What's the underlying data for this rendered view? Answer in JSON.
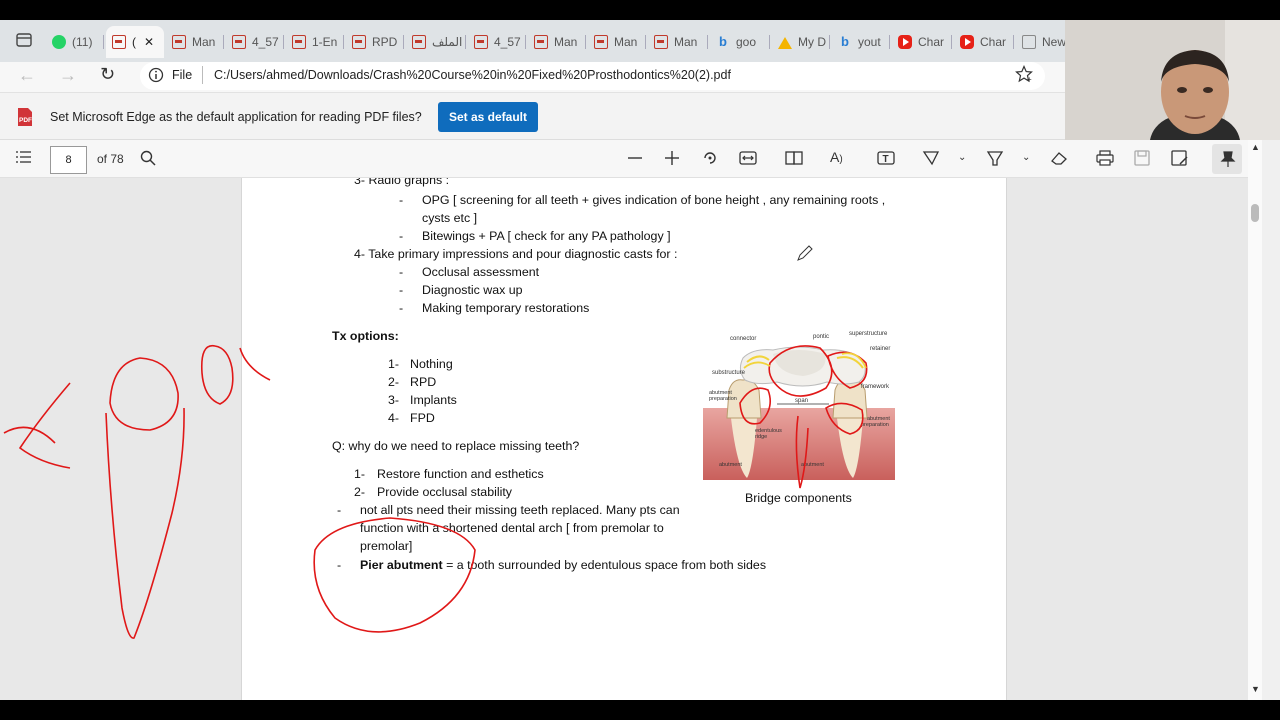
{
  "tabs": [
    {
      "label": "(11)",
      "icon": "whatsapp-icon"
    },
    {
      "label": "(",
      "icon": "pdf-icon",
      "active": true
    },
    {
      "label": "Man",
      "icon": "pdf-icon"
    },
    {
      "label": "4_57",
      "icon": "pdf-icon"
    },
    {
      "label": "1-En",
      "icon": "pdf-icon"
    },
    {
      "label": "RPD",
      "icon": "pdf-icon"
    },
    {
      "label": "الملف",
      "icon": "pdf-icon"
    },
    {
      "label": "4_57",
      "icon": "pdf-icon"
    },
    {
      "label": "Man",
      "icon": "pdf-icon"
    },
    {
      "label": "Man",
      "icon": "pdf-icon"
    },
    {
      "label": "Man",
      "icon": "pdf-icon"
    },
    {
      "label": "goo",
      "icon": "bing-icon"
    },
    {
      "label": "My D",
      "icon": "drive-icon"
    },
    {
      "label": "yout",
      "icon": "bing-icon"
    },
    {
      "label": "Char",
      "icon": "youtube-icon"
    },
    {
      "label": "Char",
      "icon": "youtube-icon"
    },
    {
      "label": "New",
      "icon": "new-tab-icon"
    }
  ],
  "addressbar": {
    "file_label": "File",
    "url": "C:/Users/ahmed/Downloads/Crash%20Course%20in%20Fixed%20Prosthodontics%20(2).pdf"
  },
  "infobar": {
    "message": "Set Microsoft Edge as the default application for reading PDF files?",
    "button": "Set as default"
  },
  "pdf_toolbar": {
    "page_number": "8",
    "page_total": "of 78"
  },
  "document": {
    "radiographs_heading": "3-   Radio graphs :",
    "opg_line1": "OPG [ screening for all teeth + gives indication of bone height , any remaining roots ,",
    "opg_line2": "cysts etc ]",
    "bitewings": "Bitewings + PA [ check for any PA pathology ]",
    "impressions": "4-   Take primary impressions and pour diagnostic casts for :",
    "occlusal": "Occlusal assessment",
    "waxup": "Diagnostic wax up",
    "temporary": "Making temporary restorations",
    "tx_options": "Tx options:",
    "tx_items": [
      "Nothing",
      "RPD",
      "Implants",
      "FPD"
    ],
    "tx_numbers": [
      "1-",
      "2-",
      "3-",
      "4-"
    ],
    "question": "Q: why do we need to replace missing teeth?",
    "answer1": "Restore function and esthetics",
    "answer2": "Provide occlusal stability",
    "answer_numbers": [
      "1-",
      "2-"
    ],
    "note_line1": "not all pts need their missing teeth replaced. Many pts can",
    "note_line2": "function with a shortened dental arch [ from premolar to",
    "note_line3": "premolar]",
    "pier_bold": "Pier abutment",
    "pier_rest": " = a tooth surrounded by edentulous space from both sides",
    "figure_caption": "Bridge components",
    "figure_labels": {
      "connector": "connector",
      "pontic": "pontic",
      "superstructure": "superstructure",
      "retainer": "retainer",
      "substructure": "substructure",
      "framework": "framework",
      "abutment_prep": "abutment",
      "abutment_prep2": "preparation",
      "span": "span",
      "edentulous": "edentulous",
      "ridge": "ridge",
      "abutment_prep_r": "abutment",
      "abutment_prep_r2": "preparation",
      "abutment_l": "abutment",
      "abutment_r": "abutment"
    }
  },
  "colors": {
    "accent": "#0f6cbd",
    "ink_red": "#e01818",
    "ink_yellow": "#f2d43a"
  }
}
